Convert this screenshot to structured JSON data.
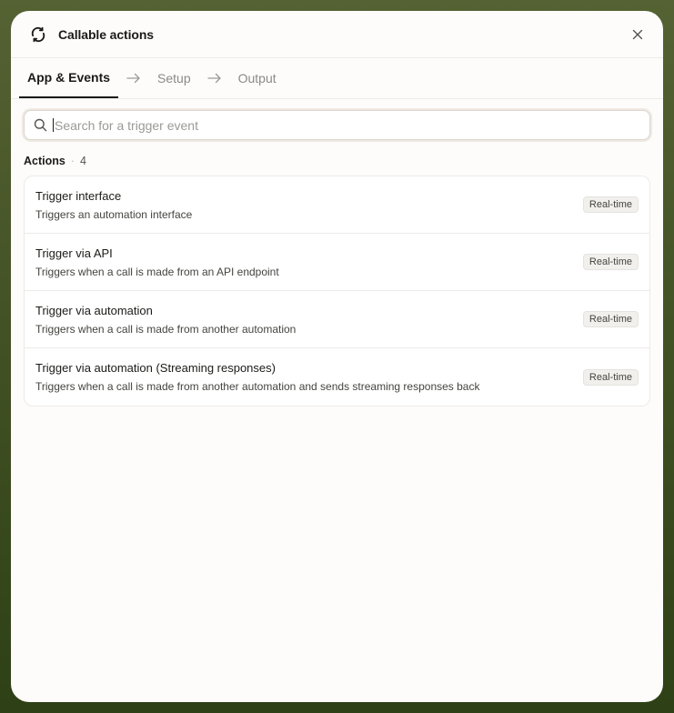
{
  "header": {
    "title": "Callable actions",
    "app_icon": "refresh-icon",
    "close_icon": "close-icon"
  },
  "steps": [
    {
      "label": "App & Events",
      "active": true
    },
    {
      "label": "Setup",
      "active": false
    },
    {
      "label": "Output",
      "active": false
    }
  ],
  "search": {
    "placeholder": "Search for a trigger event",
    "value": ""
  },
  "actions": {
    "label": "Actions",
    "count": "4",
    "items": [
      {
        "name": "Trigger interface",
        "description": "Triggers an automation interface",
        "badge": "Real-time"
      },
      {
        "name": "Trigger via API",
        "description": "Triggers when a call is made from an API endpoint",
        "badge": "Real-time"
      },
      {
        "name": "Trigger via automation",
        "description": "Triggers when a call is made from another automation",
        "badge": "Real-time"
      },
      {
        "name": "Trigger via automation (Streaming responses)",
        "description": "Triggers when a call is made from another automation and sends streaming responses back",
        "badge": "Real-time"
      }
    ]
  },
  "colors": {
    "backdrop": "#4a5a2a",
    "panel": "#fdfcfb",
    "text": "#1b1b18",
    "muted": "#8a8a86"
  }
}
